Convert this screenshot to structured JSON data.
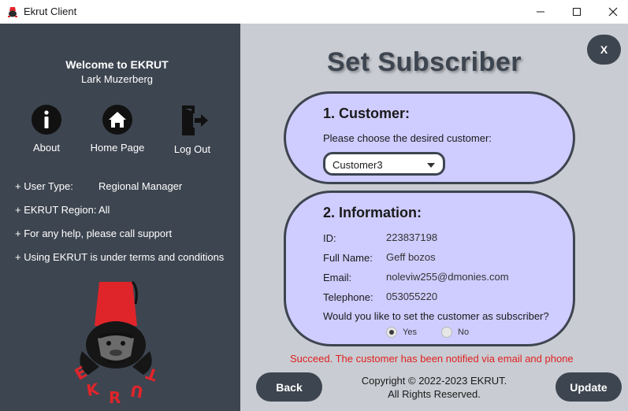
{
  "window": {
    "title": "Ekrut Client",
    "minimize_label": "—",
    "maximize_label": "☐",
    "close_label": "✕"
  },
  "sidebar": {
    "welcome": "Welcome to EKRUT",
    "user_name": "Lark Muzerberg",
    "nav": [
      {
        "label": "About",
        "icon": "info-icon"
      },
      {
        "label": "Home Page",
        "icon": "home-icon"
      },
      {
        "label": "Log Out",
        "icon": "logout-icon"
      }
    ],
    "info": {
      "user_type_label": "+ User Type:",
      "user_type_value": "Regional Manager",
      "region_label": "+ EKRUT Region:",
      "region_value": "All",
      "help": "+ For any help, please call support",
      "terms": "+ Using EKRUT is under terms and conditions"
    },
    "logo_text": "EKRUT",
    "colors": {
      "background": "#3d4550",
      "logo_red": "#e0252a"
    }
  },
  "main": {
    "close_label": "X",
    "title": "Set Subscriber",
    "customer_section": {
      "heading": "1. Customer:",
      "prompt": "Please choose the desired customer:",
      "selected_customer": "Customer3"
    },
    "information_section": {
      "heading": "2. Information:",
      "fields": {
        "id_label": "ID:",
        "id_value": "223837198",
        "full_name_label": "Full Name:",
        "full_name_value": "Geff bozos",
        "email_label": "Email:",
        "email_value": "noleviw255@dmonies.com",
        "telephone_label": "Telephone:",
        "telephone_value": "053055220"
      },
      "question": "Would you like to set the customer as subscriber?",
      "options": {
        "yes": "Yes",
        "no": "No"
      },
      "selected_option": "Yes"
    },
    "success_message": "Succeed. The customer has been notified via email and phone",
    "copyright_line1": "Copyright © 2022-2023 EKRUT.",
    "copyright_line2": "All Rights Reserved.",
    "back_label": "Back",
    "update_label": "Update",
    "colors": {
      "background": "#c9ccd2",
      "card": "#cfccff",
      "accent": "#3d4550",
      "success": "#e02020"
    }
  }
}
